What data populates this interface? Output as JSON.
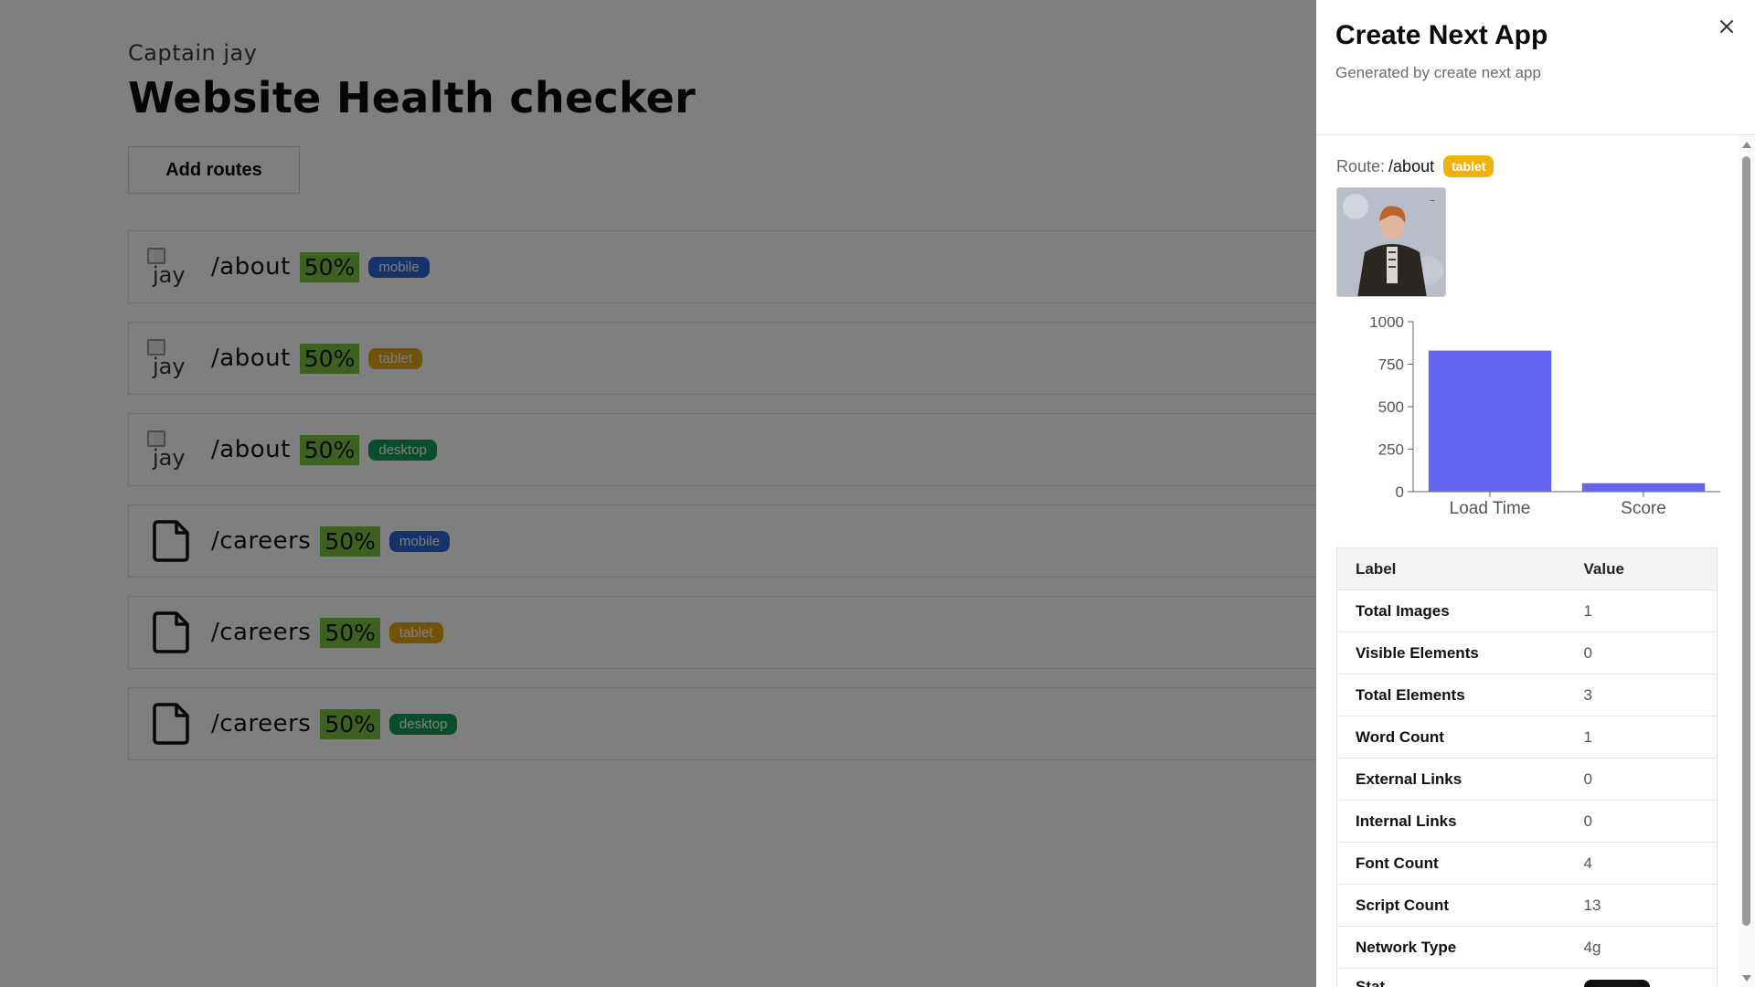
{
  "page": {
    "owner": "Captain jay",
    "title": "Website Health checker",
    "add_button": "Add routes",
    "broken_image_alt": "jay",
    "routes": [
      {
        "path": "/about",
        "score": "50%",
        "device": "mobile",
        "thumb": "broken-image"
      },
      {
        "path": "/about",
        "score": "50%",
        "device": "tablet",
        "thumb": "broken-image"
      },
      {
        "path": "/about",
        "score": "50%",
        "device": "desktop",
        "thumb": "broken-image"
      },
      {
        "path": "/careers",
        "score": "50%",
        "device": "mobile",
        "thumb": "file-icon"
      },
      {
        "path": "/careers",
        "score": "50%",
        "device": "tablet",
        "thumb": "file-icon"
      },
      {
        "path": "/careers",
        "score": "50%",
        "device": "desktop",
        "thumb": "file-icon"
      }
    ],
    "colors": {
      "score_bg": "#7bc242",
      "mobile": "#2a65d6",
      "tablet": "#e4a516",
      "desktop": "#0f9d58"
    }
  },
  "drawer": {
    "title": "Create Next App",
    "subtitle": "Generated by create next app",
    "close_icon": "close-icon",
    "route_label": "Route:",
    "route_value": "/about",
    "route_badge": "tablet",
    "table": {
      "headers": [
        "Label",
        "Value"
      ],
      "rows": [
        {
          "label": "Total Images",
          "value": "1"
        },
        {
          "label": "Visible Elements",
          "value": "0"
        },
        {
          "label": "Total Elements",
          "value": "3"
        },
        {
          "label": "Word Count",
          "value": "1"
        },
        {
          "label": "External Links",
          "value": "0"
        },
        {
          "label": "Internal Links",
          "value": "0"
        },
        {
          "label": "Font Count",
          "value": "4"
        },
        {
          "label": "Script Count",
          "value": "13"
        },
        {
          "label": "Network Type",
          "value": "4g"
        },
        {
          "label": "Stat",
          "value": ""
        }
      ]
    }
  },
  "chart_data": {
    "type": "bar",
    "categories": [
      "Load Time",
      "Score"
    ],
    "values": [
      830,
      50
    ],
    "yticks": [
      0,
      250,
      500,
      750,
      1000
    ],
    "ylim": [
      0,
      1000
    ],
    "color": "#6366f1",
    "title": "",
    "xlabel": "",
    "ylabel": ""
  }
}
